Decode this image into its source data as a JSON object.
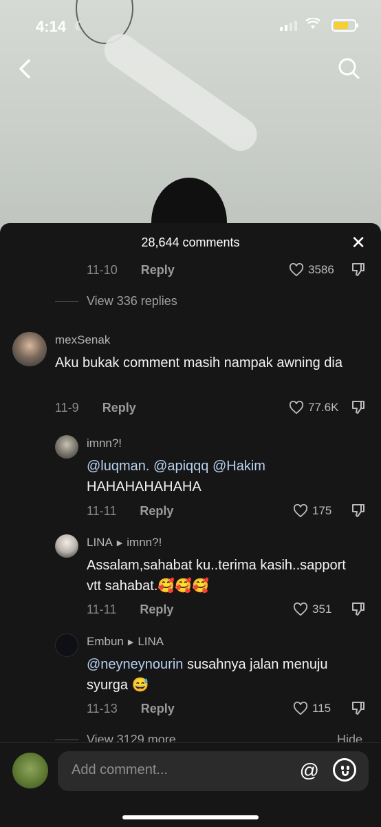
{
  "status": {
    "time": "4:14"
  },
  "sheet": {
    "title": "28,644 comments"
  },
  "top_comment": {
    "date": "11-10",
    "reply_label": "Reply",
    "likes": "3586",
    "view_replies": "View 336 replies"
  },
  "comments": [
    {
      "user": "mexSenak",
      "text": "Aku bukak comment masih nampak awning dia",
      "date": "11-9",
      "reply_label": "Reply",
      "likes": "77.6K"
    }
  ],
  "replies": [
    {
      "user": "imnn?!",
      "mentions": [
        "@luqman.",
        "@apiqqq",
        "@Hakim"
      ],
      "text": "HAHAHAHAHAHA",
      "date": "11-11",
      "reply_label": "Reply",
      "likes": "175"
    },
    {
      "user": "LINA",
      "reply_to": "imnn?!",
      "text": "Assalam,sahabat ku..terima kasih..sapport vtt sahabat.🥰🥰🥰",
      "date": "11-11",
      "reply_label": "Reply",
      "likes": "351"
    },
    {
      "user": "Embun",
      "reply_to": "LINA",
      "mention": "@neyneynourin",
      "text": " susahnya jalan menuju syurga 😅",
      "date": "11-13",
      "reply_label": "Reply",
      "likes": "115"
    }
  ],
  "more": {
    "view_more": "View 3129 more",
    "hide": "Hide"
  },
  "composer": {
    "placeholder": "Add comment..."
  },
  "colors": {
    "sheet_bg": "#161616",
    "mention": "#b8d2f0",
    "battery": "#f5d02f"
  }
}
